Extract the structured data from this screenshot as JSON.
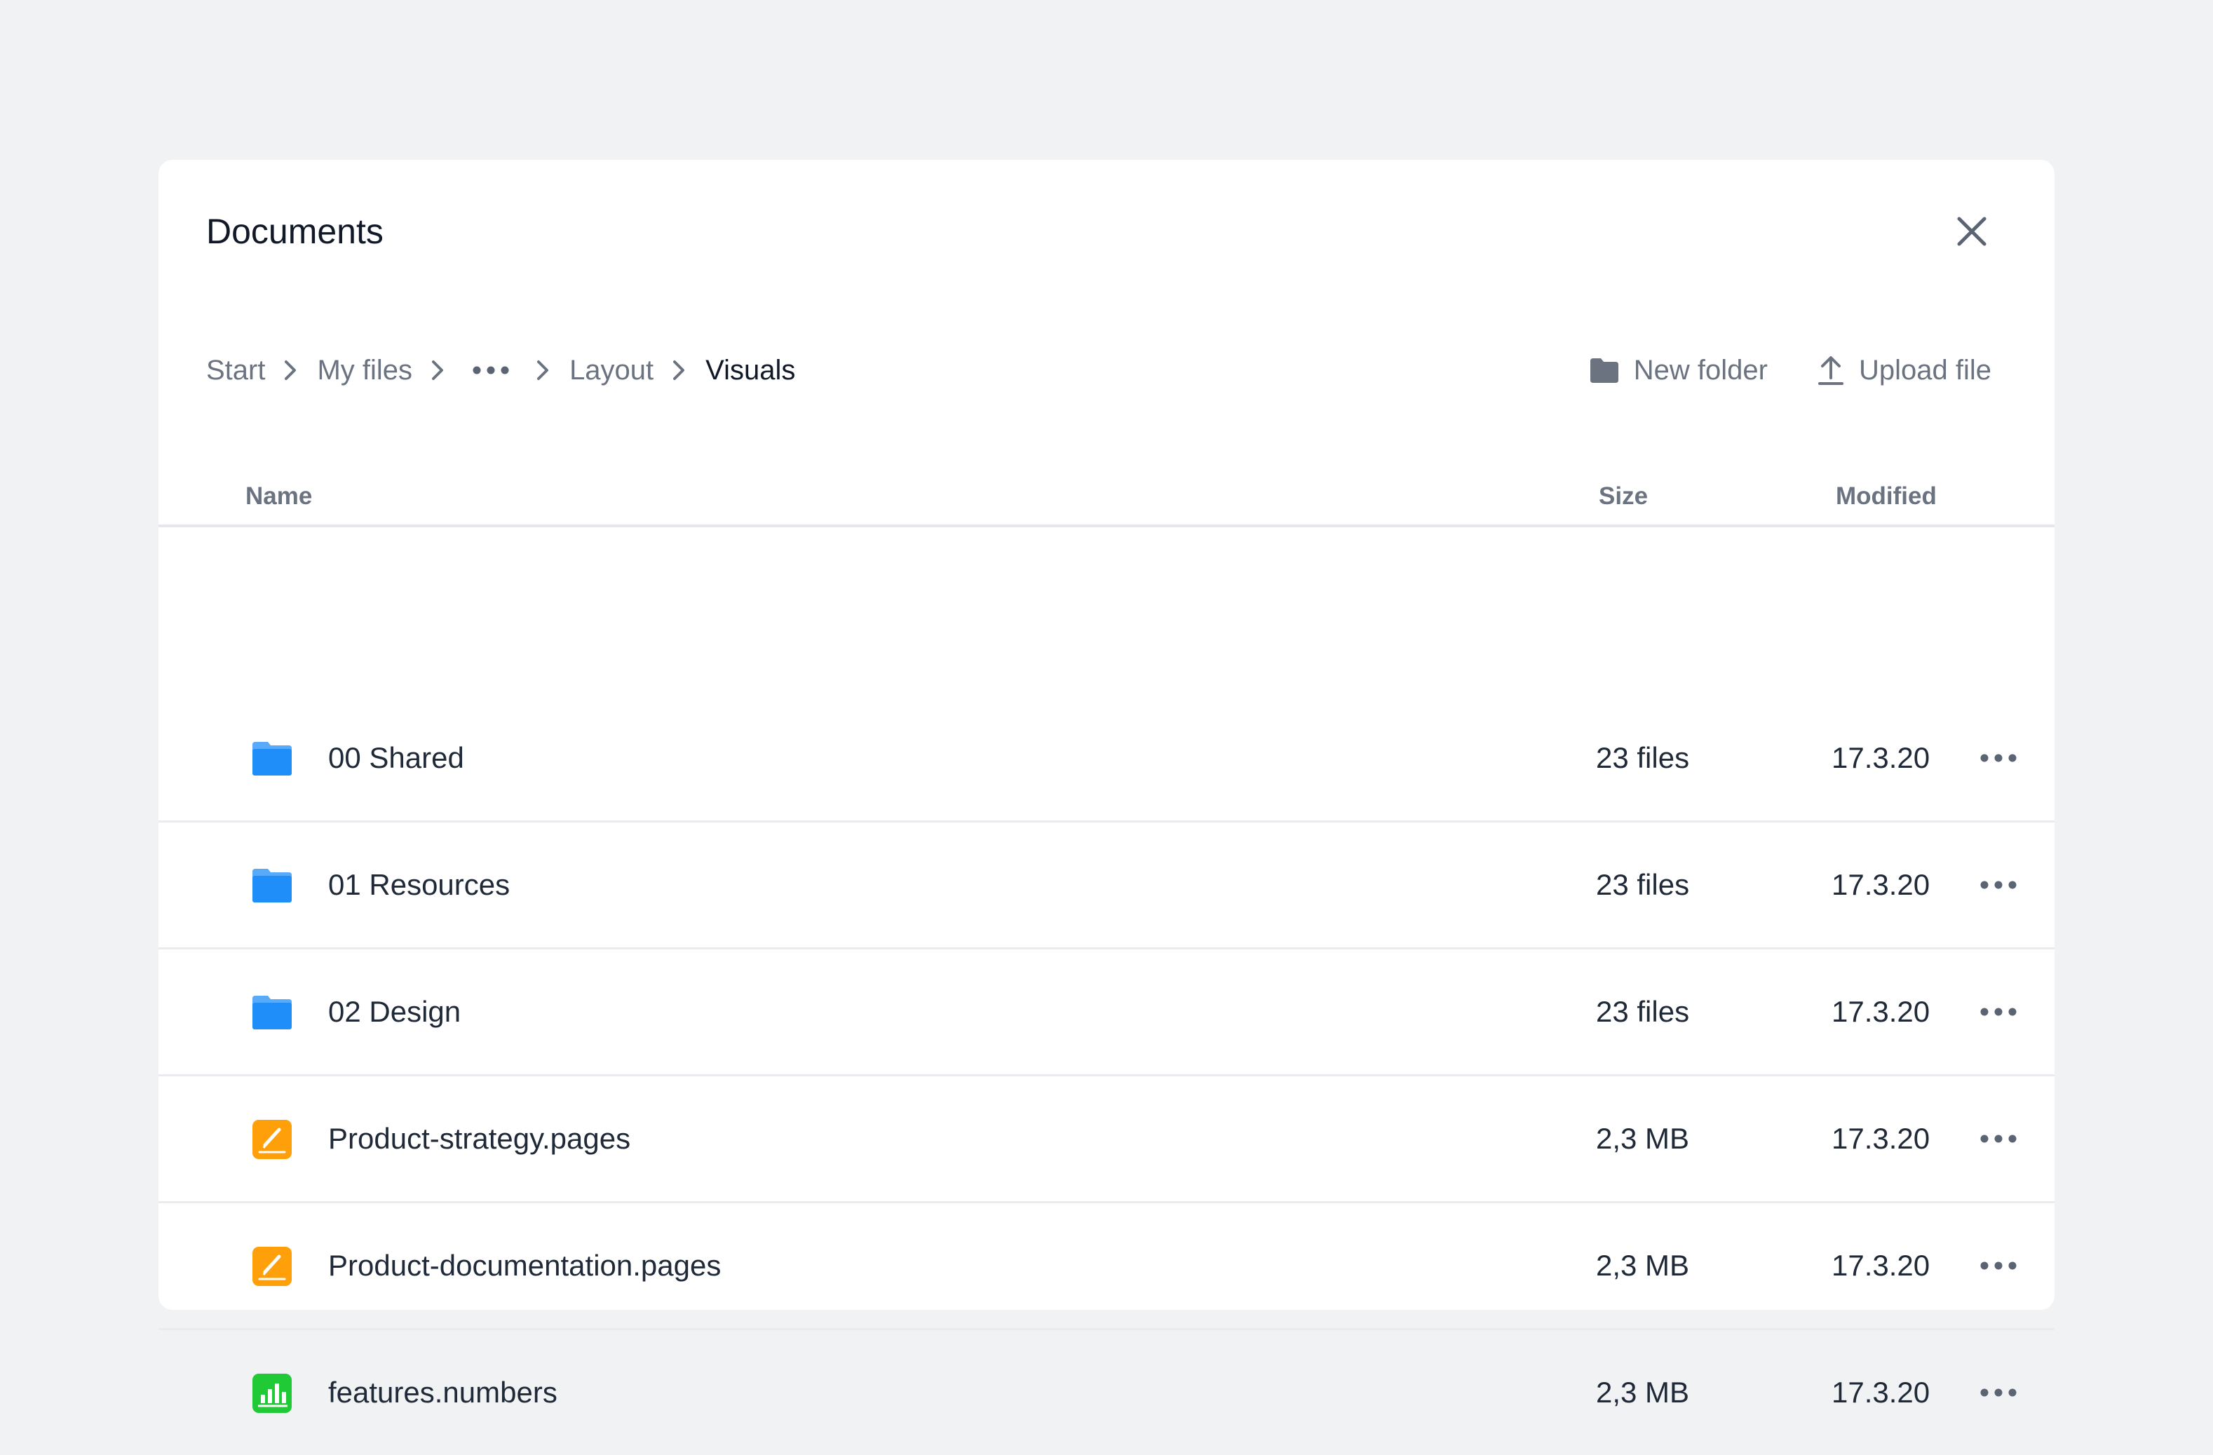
{
  "dialog": {
    "title": "Documents",
    "close_icon": "close-icon"
  },
  "breadcrumb": {
    "items": [
      "Start",
      "My files",
      "Layout",
      "Visuals"
    ],
    "separator_icon": "chevron-right-icon",
    "overflow_icon": "more-horizontal-icon"
  },
  "toolbar": {
    "new_folder_label": "New folder",
    "new_folder_icon": "folder-icon",
    "upload_label": "Upload file",
    "upload_icon": "upload-icon"
  },
  "table": {
    "columns": {
      "name": "Name",
      "size": "Size",
      "modified": "Modified"
    },
    "rows": [
      {
        "icon": "folder-icon",
        "name": "00 Shared",
        "size": "23 files",
        "modified": "17.3.20"
      },
      {
        "icon": "folder-icon",
        "name": "01 Resources",
        "size": "23 files",
        "modified": "17.3.20"
      },
      {
        "icon": "folder-icon",
        "name": "02 Design",
        "size": "23 files",
        "modified": "17.3.20"
      },
      {
        "icon": "pages-file-icon",
        "name": "Product-strategy.pages",
        "size": "2,3 MB",
        "modified": "17.3.20"
      },
      {
        "icon": "pages-file-icon",
        "name": "Product-documentation.pages",
        "size": "2,3 MB",
        "modified": "17.3.20"
      },
      {
        "icon": "numbers-file-icon",
        "name": "features.numbers",
        "size": "2,3 MB",
        "modified": "17.3.20"
      }
    ],
    "row_action_icon": "more-horizontal-icon"
  },
  "colors": {
    "background": "#f1f2f4",
    "surface": "#ffffff",
    "folder": "#1f8ef8",
    "folder_tab": "#5aaafa",
    "pages": "#ff9f0a",
    "numbers": "#20c936",
    "muted_text": "#6b7280",
    "text": "#1f2937"
  }
}
